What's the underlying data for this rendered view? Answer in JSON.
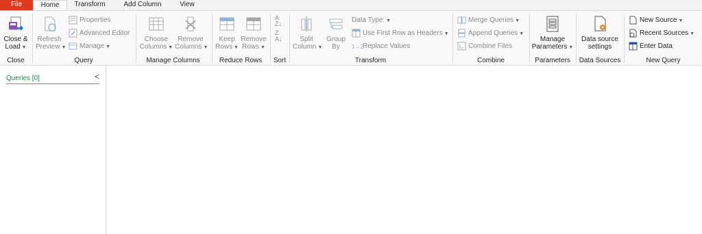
{
  "tabs": [
    {
      "label": "File"
    },
    {
      "label": "Home"
    },
    {
      "label": "Transform"
    },
    {
      "label": "Add Column"
    },
    {
      "label": "View"
    }
  ],
  "groups": {
    "close": {
      "label": "Close",
      "close_load": "Close &",
      "close_load2": "Load"
    },
    "query": {
      "label": "Query",
      "refresh": "Refresh",
      "refresh2": "Preview",
      "properties": "Properties",
      "advanced_editor": "Advanced Editor",
      "manage": "Manage"
    },
    "manage_columns": {
      "label": "Manage Columns",
      "choose": "Choose",
      "choose2": "Columns",
      "remove": "Remove",
      "remove2": "Columns"
    },
    "reduce_rows": {
      "label": "Reduce Rows",
      "keep": "Keep",
      "keep2": "Rows",
      "remove": "Remove",
      "remove2": "Rows"
    },
    "sort": {
      "label": "Sort"
    },
    "transform": {
      "label": "Transform",
      "split": "Split",
      "split2": "Column",
      "group": "Group",
      "group2": "By",
      "data_type": "Data Type:",
      "first_row": "Use First Row as Headers",
      "replace": "Replace Values"
    },
    "combine": {
      "label": "Combine",
      "merge": "Merge Queries",
      "append": "Append Queries",
      "combine_files": "Combine Files"
    },
    "parameters": {
      "label": "Parameters",
      "manage": "Manage",
      "manage2": "Parameters"
    },
    "data_sources": {
      "label": "Data Sources",
      "settings": "Data source",
      "settings2": "settings"
    },
    "new_query": {
      "label": "New Query",
      "new_source": "New Source",
      "recent_sources": "Recent Sources",
      "enter_data": "Enter Data"
    }
  },
  "left_pane": {
    "title": "Queries [0]",
    "collapse": "<"
  },
  "colors": {
    "file_tab": "#e03a1e",
    "accent_green": "#2b7b50",
    "disabled": "#8a8886"
  }
}
